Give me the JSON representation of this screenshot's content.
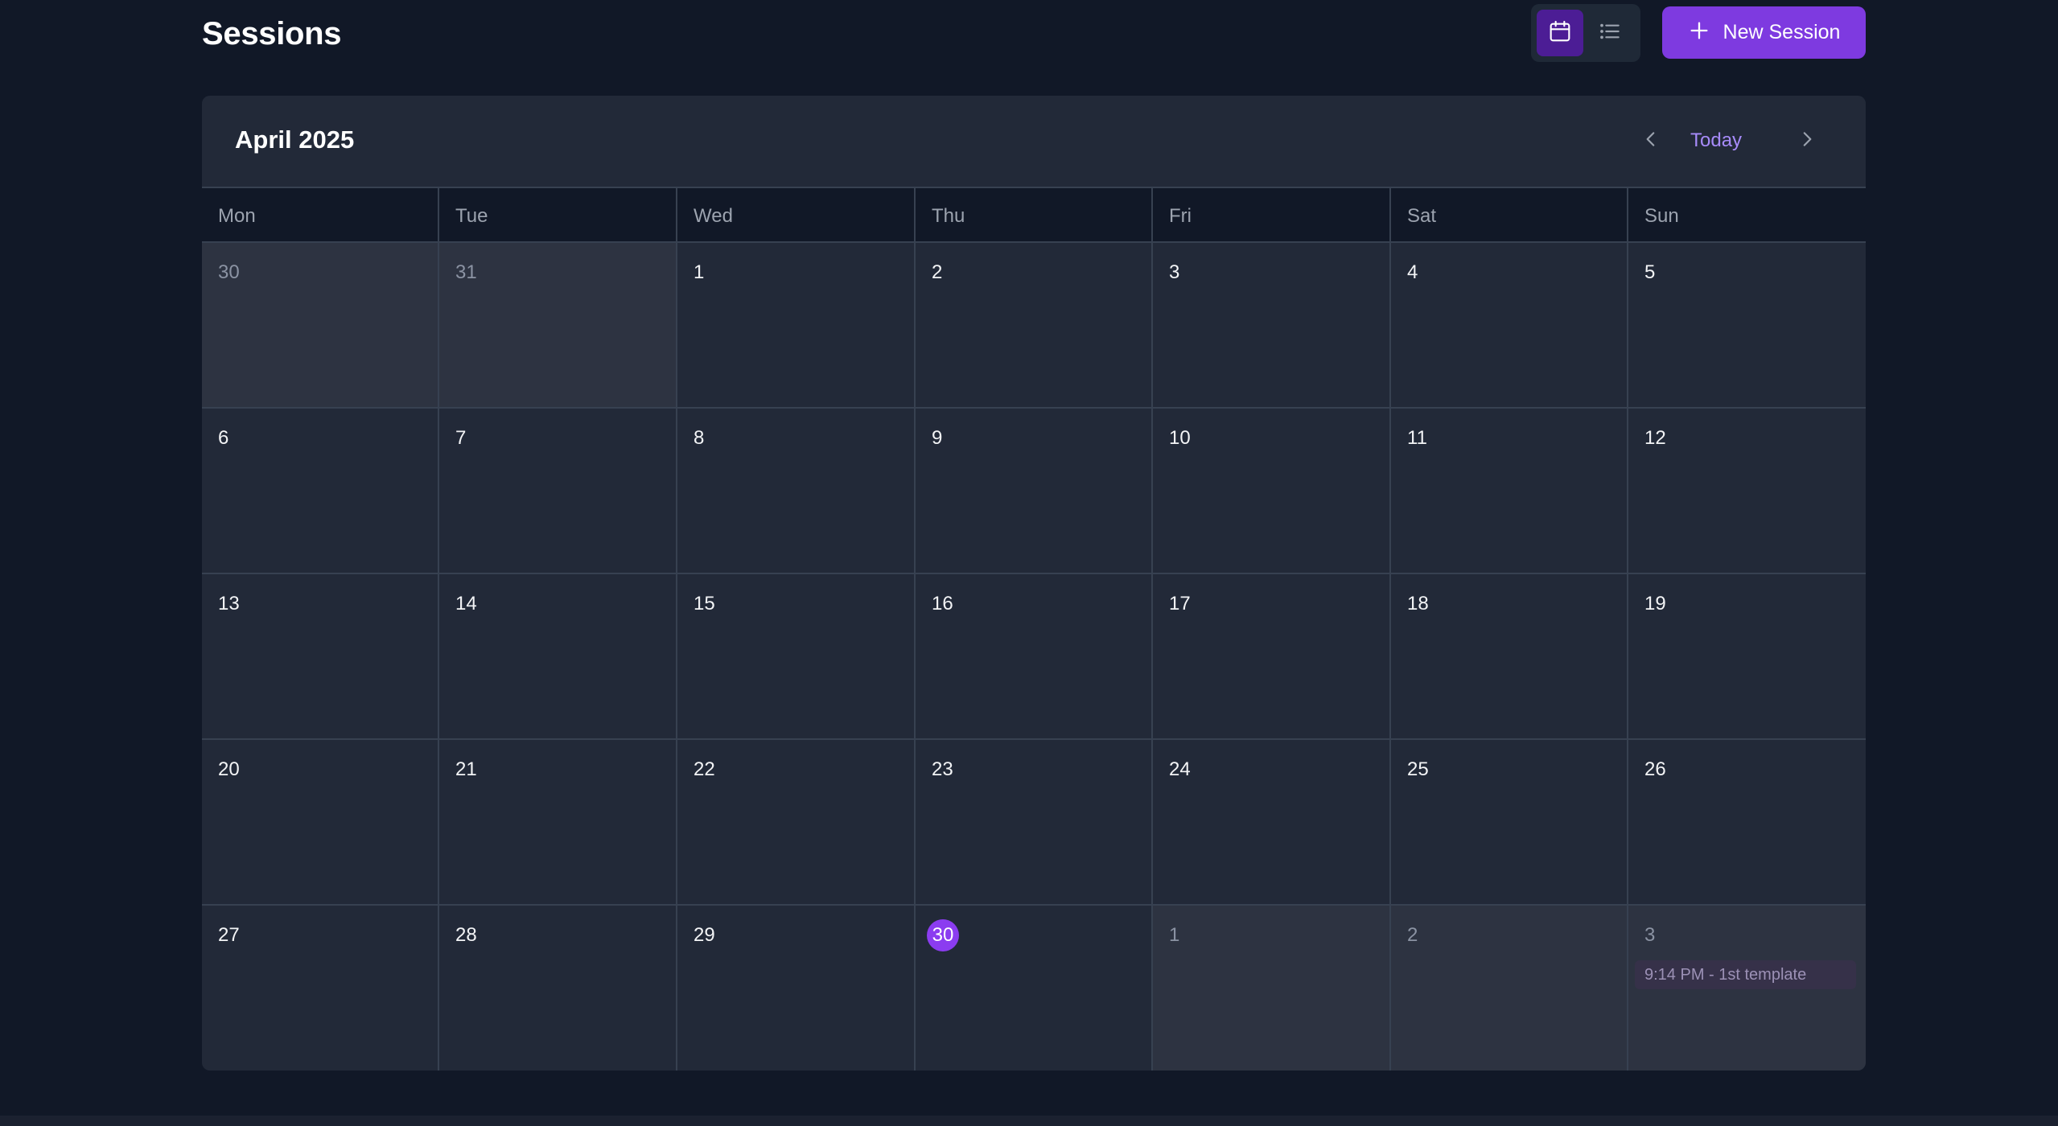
{
  "page": {
    "title": "Sessions"
  },
  "toolbar": {
    "views": [
      {
        "name": "calendar",
        "icon": "calendar-icon",
        "active": true
      },
      {
        "name": "list",
        "icon": "list-icon",
        "active": false
      }
    ],
    "new_session_label": "New Session",
    "new_session_icon": "plus-icon"
  },
  "calendar": {
    "month_label": "April 2025",
    "today_label": "Today",
    "prev_icon": "chevron-left-icon",
    "next_icon": "chevron-right-icon",
    "weekdays": [
      "Mon",
      "Tue",
      "Wed",
      "Thu",
      "Fri",
      "Sat",
      "Sun"
    ],
    "weeks": [
      [
        {
          "day": "30",
          "outside": true
        },
        {
          "day": "31",
          "outside": true
        },
        {
          "day": "1"
        },
        {
          "day": "2"
        },
        {
          "day": "3"
        },
        {
          "day": "4"
        },
        {
          "day": "5"
        }
      ],
      [
        {
          "day": "6"
        },
        {
          "day": "7"
        },
        {
          "day": "8"
        },
        {
          "day": "9"
        },
        {
          "day": "10"
        },
        {
          "day": "11"
        },
        {
          "day": "12"
        }
      ],
      [
        {
          "day": "13"
        },
        {
          "day": "14"
        },
        {
          "day": "15"
        },
        {
          "day": "16"
        },
        {
          "day": "17"
        },
        {
          "day": "18"
        },
        {
          "day": "19"
        }
      ],
      [
        {
          "day": "20"
        },
        {
          "day": "21"
        },
        {
          "day": "22"
        },
        {
          "day": "23"
        },
        {
          "day": "24"
        },
        {
          "day": "25"
        },
        {
          "day": "26"
        }
      ],
      [
        {
          "day": "27"
        },
        {
          "day": "28"
        },
        {
          "day": "29"
        },
        {
          "day": "30",
          "today": true
        },
        {
          "day": "1",
          "outside": true
        },
        {
          "day": "2",
          "outside": true
        },
        {
          "day": "3",
          "outside": true,
          "events": [
            "9:14 PM - 1st template"
          ]
        }
      ]
    ]
  },
  "colors": {
    "background": "#111827",
    "card": "#222938",
    "accent": "#7e3ae0",
    "today_badge": "#8b3cf0",
    "link": "#a78bfa"
  }
}
